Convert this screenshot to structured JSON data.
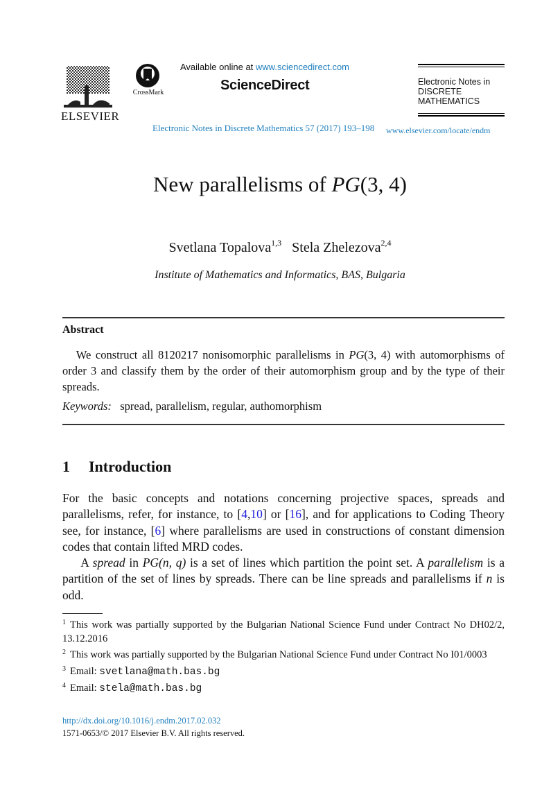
{
  "header": {
    "publisher_wordmark": "ELSEVIER",
    "crossmark_label": "CrossMark",
    "available_prefix": "Available online at ",
    "available_url": "www.sciencedirect.com",
    "brand": "ScienceDirect",
    "journal_citation": "Electronic Notes in Discrete Mathematics 57 (2017) 193–198",
    "journal_box": [
      "Electronic Notes in",
      "DISCRETE",
      "MATHEMATICS"
    ],
    "journal_url": "www.elsevier.com/locate/endm",
    "link_color": "#1f7fbf"
  },
  "paper": {
    "title_text": "New parallelisms of ",
    "title_math": "PG",
    "title_args": "(3, 4)",
    "authors": [
      {
        "name": "Svetlana Topalova",
        "marks": "1,3"
      },
      {
        "name": "Stela Zhelezova",
        "marks": "2,4"
      }
    ],
    "affiliation": "Institute of Mathematics and Informatics, BAS, Bulgaria"
  },
  "abstract": {
    "heading": "Abstract",
    "text_1": "We construct all 8120217 nonisomorphic parallelisms in ",
    "math": "PG",
    "math_args": "(3, 4)",
    "text_2": " with automorphisms of order 3 and classify them by the order of their automorphism group and by the type of their spreads.",
    "keywords_label": "Keywords:",
    "keywords": "spread, parallelism, regular, authomorphism"
  },
  "section": {
    "number": "1",
    "title": "Introduction",
    "p1_a": "For the basic concepts and notations concerning projective spaces, spreads and parallelisms, refer, for instance, to [",
    "cite_4": "4",
    "comma": ",",
    "cite_10": "10",
    "p1_b": "] or [",
    "cite_16": "16",
    "p1_c": "], and for applications to Coding Theory see, for instance, [",
    "cite_6": "6",
    "p1_d": "] where parallelisms are used in constructions of constant dimension codes that contain lifted MRD codes.",
    "p2_a": "A ",
    "p2_spread": "spread",
    "p2_b": " in ",
    "p2_math": "PG",
    "p2_args": "(n, q)",
    "p2_c": " is a set of lines which partition the point set.  A ",
    "p2_parallelism": "parallelism",
    "p2_d": " is a partition of the set of lines by spreads.  There can be line spreads and parallelisms if ",
    "p2_n": "n",
    "p2_e": " is odd.",
    "cite_color": "#2222dd"
  },
  "footnotes": [
    {
      "mark": "1",
      "text": "This work was partially supported by the Bulgarian National Science Fund under Contract No DH02/2, 13.12.2016"
    },
    {
      "mark": "2",
      "text": "This work was partially supported by the Bulgarian National Science Fund under Contract No I01/0003"
    },
    {
      "mark": "3",
      "label": "Email: ",
      "email": "svetlana@math.bas.bg"
    },
    {
      "mark": "4",
      "label": "Email: ",
      "email": "stela@math.bas.bg"
    }
  ],
  "footer": {
    "doi": "http://dx.doi.org/10.1016/j.endm.2017.02.032",
    "copyright": "1571-0653/© 2017 Elsevier B.V. All rights reserved."
  }
}
